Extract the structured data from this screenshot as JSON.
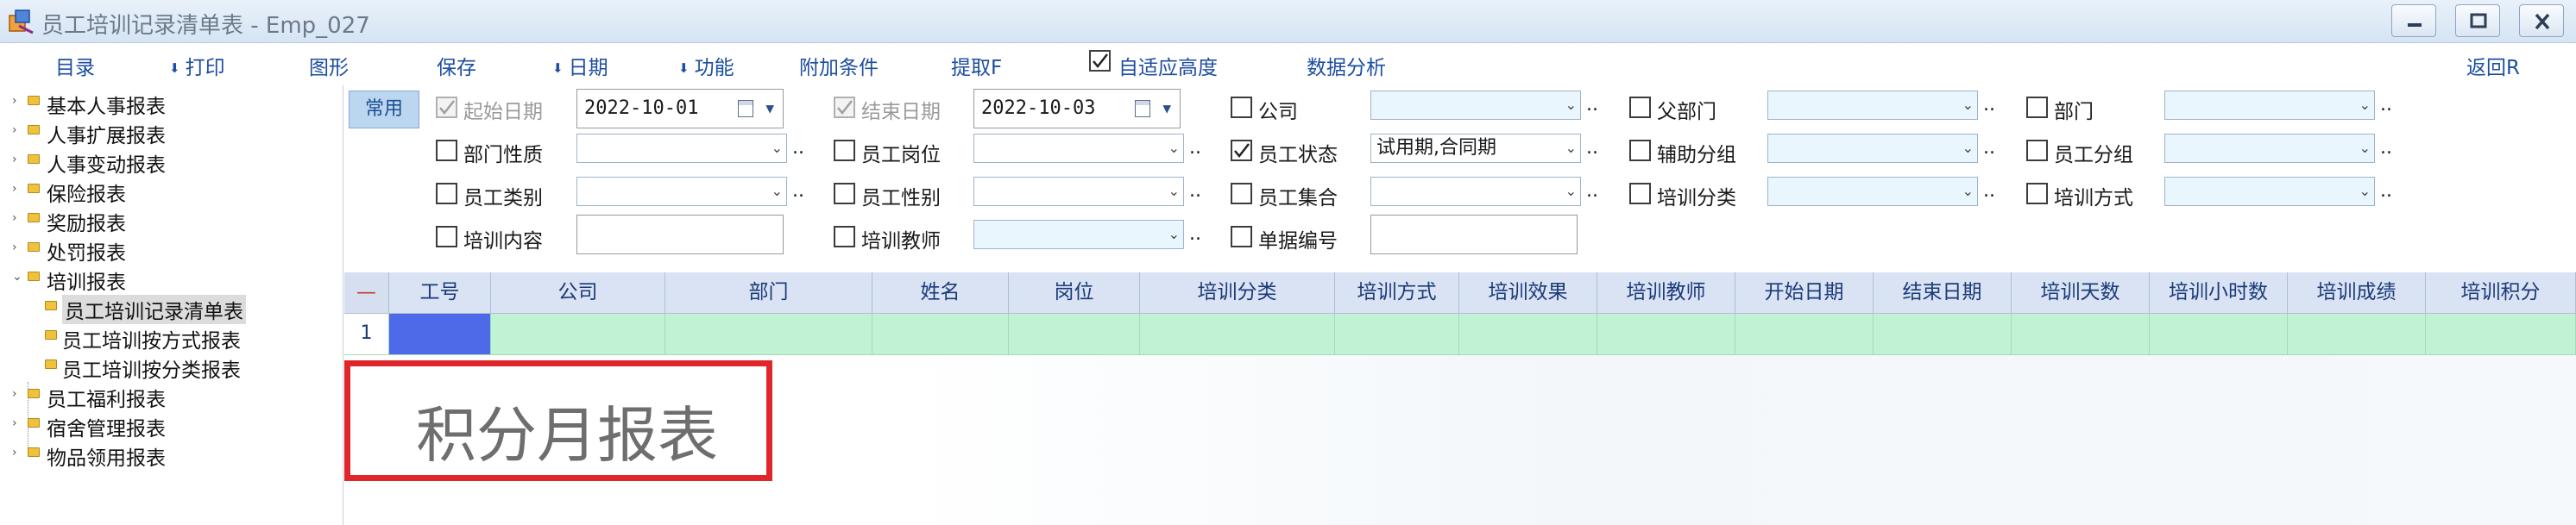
{
  "window": {
    "title": "员工培训记录清单表 - Emp_027",
    "buttons": [
      "minimize",
      "maximize",
      "close"
    ]
  },
  "menu": {
    "items": [
      {
        "label": "目录",
        "arrow": false
      },
      {
        "label": "打印",
        "arrow": true
      },
      {
        "label": "图形",
        "arrow": false
      },
      {
        "label": "保存",
        "arrow": false
      },
      {
        "label": "日期",
        "arrow": true
      },
      {
        "label": "功能",
        "arrow": true
      },
      {
        "label": "附加条件",
        "arrow": false
      },
      {
        "label": "提取F",
        "arrow": false
      },
      {
        "label": "自适应高度",
        "arrow": false,
        "checked": true
      },
      {
        "label": "数据分析",
        "arrow": false
      },
      {
        "label": "返回R",
        "arrow": false
      }
    ],
    "arrow_glyph": "⬇"
  },
  "tree": {
    "expand_collapsed": "›",
    "expand_open": "⌄",
    "nodes": [
      {
        "label": "基本人事报表",
        "expanded": false
      },
      {
        "label": "人事扩展报表",
        "expanded": false
      },
      {
        "label": "人事变动报表",
        "expanded": false
      },
      {
        "label": "保险报表",
        "expanded": false
      },
      {
        "label": "奖励报表",
        "expanded": false
      },
      {
        "label": "处罚报表",
        "expanded": false
      },
      {
        "label": "培训报表",
        "expanded": true,
        "children": [
          {
            "label": "员工培训记录清单表",
            "selected": true
          },
          {
            "label": "员工培训按方式报表",
            "selected": false
          },
          {
            "label": "员工培训按分类报表",
            "selected": false
          }
        ]
      },
      {
        "label": "员工福利报表",
        "expanded": false
      },
      {
        "label": "宿舍管理报表",
        "expanded": false
      },
      {
        "label": "物品领用报表",
        "expanded": false
      }
    ]
  },
  "filters": {
    "tab_label": "常用",
    "start_date": {
      "label": "起始日期",
      "value": "2022-10-01",
      "checked": true,
      "disabled": true
    },
    "end_date": {
      "label": "结束日期",
      "value": "2022-10-03",
      "checked": true,
      "disabled": true
    },
    "fields": [
      {
        "id": "company",
        "label": "公司",
        "checked": false,
        "value": "",
        "tint": true
      },
      {
        "id": "parent-dept",
        "label": "父部门",
        "checked": false,
        "value": "",
        "tint": true
      },
      {
        "id": "dept",
        "label": "部门",
        "checked": false,
        "value": "",
        "tint": true
      },
      {
        "id": "dept-nature",
        "label": "部门性质",
        "checked": false,
        "value": "",
        "tint": false
      },
      {
        "id": "position",
        "label": "员工岗位",
        "checked": false,
        "value": "",
        "tint": false
      },
      {
        "id": "emp-status",
        "label": "员工状态",
        "checked": true,
        "value": "试用期,合同期",
        "tint": false
      },
      {
        "id": "aux-group",
        "label": "辅助分组",
        "checked": false,
        "value": "",
        "tint": true
      },
      {
        "id": "emp-group",
        "label": "员工分组",
        "checked": false,
        "value": "",
        "tint": true
      },
      {
        "id": "emp-category",
        "label": "员工类别",
        "checked": false,
        "value": "",
        "tint": false
      },
      {
        "id": "emp-gender",
        "label": "员工性别",
        "checked": false,
        "value": "",
        "tint": false
      },
      {
        "id": "emp-set",
        "label": "员工集合",
        "checked": false,
        "value": "",
        "tint": false
      },
      {
        "id": "train-category",
        "label": "培训分类",
        "checked": false,
        "value": "",
        "tint": true
      },
      {
        "id": "train-method",
        "label": "培训方式",
        "checked": false,
        "value": "",
        "tint": true
      },
      {
        "id": "train-content",
        "label": "培训内容",
        "checked": false,
        "value": ""
      },
      {
        "id": "train-teacher",
        "label": "培训教师",
        "checked": false,
        "value": "",
        "tint": true
      },
      {
        "id": "doc-number",
        "label": "单据编号",
        "checked": false,
        "value": ""
      }
    ],
    "dots": ".."
  },
  "grid": {
    "corner": "—",
    "columns": [
      "工号",
      "公司",
      "部门",
      "姓名",
      "岗位",
      "培训分类",
      "培训方式",
      "培训效果",
      "培训教师",
      "开始日期",
      "结束日期",
      "培训天数",
      "培训小时数",
      "培训成绩",
      "培训积分"
    ],
    "rows": [
      {
        "num": "1",
        "cells": [
          "",
          "",
          "",
          "",
          "",
          "",
          "",
          "",
          "",
          "",
          "",
          "",
          "",
          "",
          ""
        ]
      }
    ]
  },
  "overlay": {
    "text": "积分月报表",
    "border_color": "#e0262b"
  },
  "colors": {
    "header_bg": "#d9e3f4",
    "row_bg": "#bff3d3",
    "selected_cell": "#4f6ae8",
    "menu_text": "#1d4ea0"
  }
}
